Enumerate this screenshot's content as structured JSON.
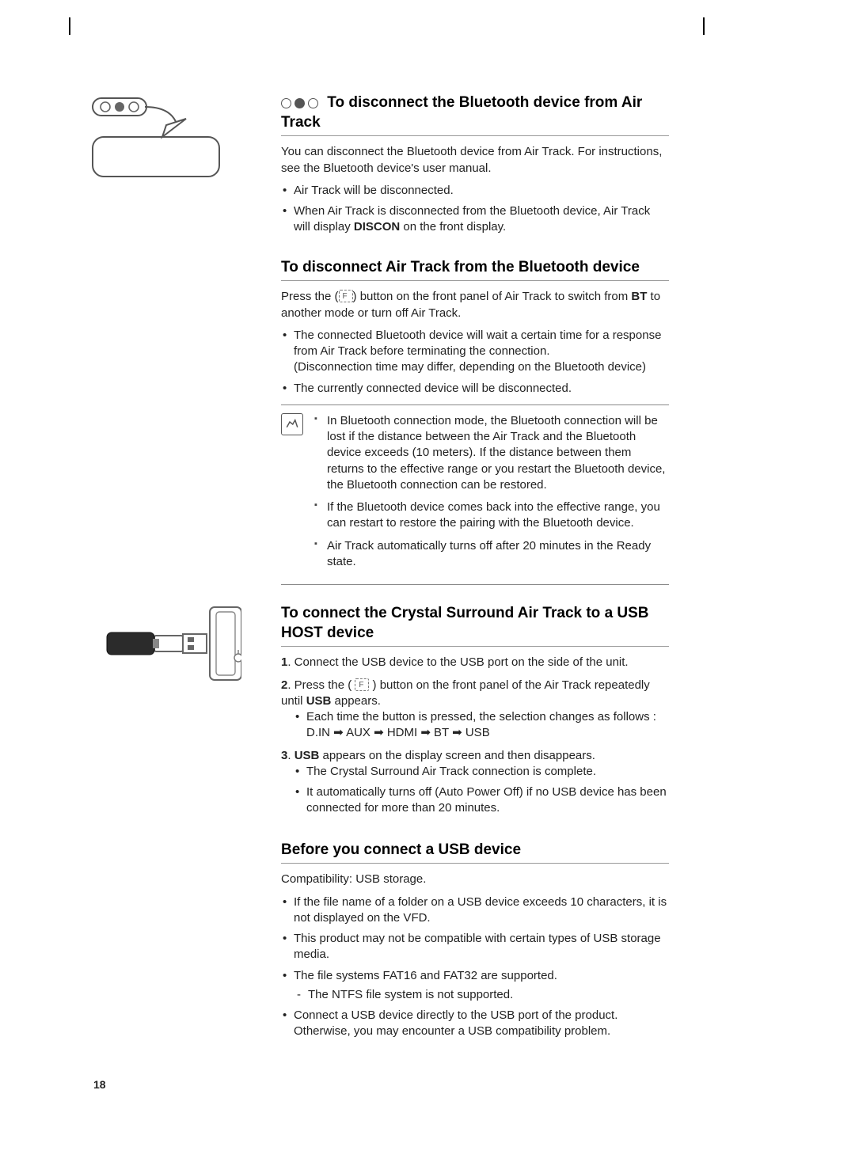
{
  "page_number": "18",
  "sections": {
    "bt1": {
      "title": "To disconnect the Bluetooth device from Air Track",
      "intro": "You can disconnect the Bluetooth device from Air Track. For instructions, see the Bluetooth device's user manual.",
      "b1": "Air Track will be disconnected.",
      "b2_pre": "When Air Track is disconnected from the Bluetooth device, Air Track will display ",
      "b2_bold": "DISCON",
      "b2_post": " on the front display."
    },
    "bt2": {
      "title": "To disconnect Air Track from the Bluetooth device",
      "intro_pre": "Press the (",
      "intro_mid": ") button on the front panel of Air Track to switch from ",
      "intro_bold": "BT",
      "intro_post": " to another mode or turn off Air Track.",
      "b1": "The connected Bluetooth device will wait a certain time for a response from Air Track before terminating the connection.\n(Disconnection time may differ, depending on the Bluetooth device)",
      "b2": "The currently connected device will be disconnected.",
      "note1": "In Bluetooth connection mode, the Bluetooth connection will be lost if the distance between the Air Track and the Bluetooth device exceeds (10 meters). If the distance between them returns to the effective range or you restart the Bluetooth device, the Bluetooth connection can be restored.",
      "note2": "If the Bluetooth device comes back into the effective range, you can restart to restore the pairing with the Bluetooth device.",
      "note3": "Air Track automatically turns off after 20 minutes in the Ready state."
    },
    "usb1": {
      "title": "To connect the Crystal Surround Air Track to a USB HOST device",
      "s1_num": "1",
      "s1": ". Connect the USB device to the USB port on the side of the unit.",
      "s2_num": "2",
      "s2_pre": ". Press the ( ",
      "s2_mid": " ) button on the front panel of the Air Track repeatedly until ",
      "s2_bold": "USB",
      "s2_post": " appears.",
      "s2_sub": "Each time the button is pressed, the selection changes as follows :",
      "s2_chain": "D.IN ➡ AUX ➡ HDMI ➡ BT ➡ USB",
      "s3_num": "3",
      "s3_bold": "USB",
      "s3_post": " appears on the display screen and then disappears.",
      "s3_sub1": "The Crystal Surround Air Track connection is complete.",
      "s3_sub2": "It automatically turns off (Auto Power Off) if no USB device has been connected for more than 20 minutes."
    },
    "usb2": {
      "title": "Before you connect a USB device",
      "intro": "Compatibility: USB storage.",
      "b1": "If the file name of a folder on a USB device exceeds 10 characters, it is not displayed on the VFD.",
      "b2": "This product may not be compatible with certain types of USB storage media.",
      "b3": "The file systems FAT16 and FAT32 are supported.",
      "b3_sub": "The NTFS file system is not supported.",
      "b4": "Connect a USB device directly to the USB port of the product. Otherwise, you may encounter a USB compatibility problem."
    }
  }
}
